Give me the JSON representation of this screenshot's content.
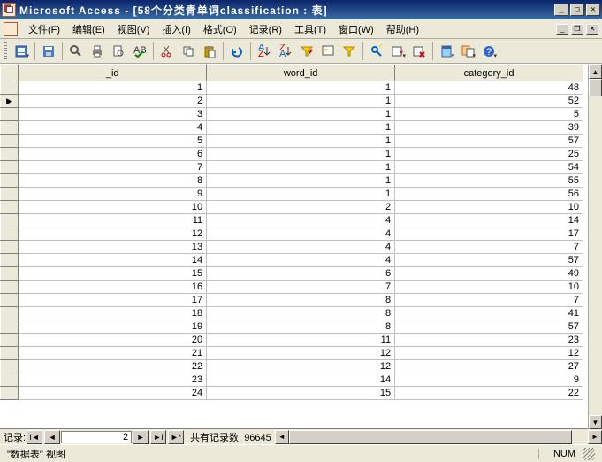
{
  "title": "Microsoft Access - [58个分类青单词classification : 表]",
  "menu": {
    "file": "文件(F)",
    "edit": "编辑(E)",
    "view": "视图(V)",
    "insert": "插入(I)",
    "format": "格式(O)",
    "records": "记录(R)",
    "tools": "工具(T)",
    "window": "窗口(W)",
    "help": "帮助(H)"
  },
  "columns": [
    "_id",
    "word_id",
    "category_id"
  ],
  "rows": [
    {
      "_id": 1,
      "word_id": 1,
      "category_id": 48
    },
    {
      "_id": 2,
      "word_id": 1,
      "category_id": 52
    },
    {
      "_id": 3,
      "word_id": 1,
      "category_id": 5
    },
    {
      "_id": 4,
      "word_id": 1,
      "category_id": 39
    },
    {
      "_id": 5,
      "word_id": 1,
      "category_id": 57
    },
    {
      "_id": 6,
      "word_id": 1,
      "category_id": 25
    },
    {
      "_id": 7,
      "word_id": 1,
      "category_id": 54
    },
    {
      "_id": 8,
      "word_id": 1,
      "category_id": 55
    },
    {
      "_id": 9,
      "word_id": 1,
      "category_id": 56
    },
    {
      "_id": 10,
      "word_id": 2,
      "category_id": 10
    },
    {
      "_id": 11,
      "word_id": 4,
      "category_id": 14
    },
    {
      "_id": 12,
      "word_id": 4,
      "category_id": 17
    },
    {
      "_id": 13,
      "word_id": 4,
      "category_id": 7
    },
    {
      "_id": 14,
      "word_id": 4,
      "category_id": 57
    },
    {
      "_id": 15,
      "word_id": 6,
      "category_id": 49
    },
    {
      "_id": 16,
      "word_id": 7,
      "category_id": 10
    },
    {
      "_id": 17,
      "word_id": 8,
      "category_id": 7
    },
    {
      "_id": 18,
      "word_id": 8,
      "category_id": 41
    },
    {
      "_id": 19,
      "word_id": 8,
      "category_id": 57
    },
    {
      "_id": 20,
      "word_id": 11,
      "category_id": 23
    },
    {
      "_id": 21,
      "word_id": 12,
      "category_id": 12
    },
    {
      "_id": 22,
      "word_id": 12,
      "category_id": 27
    },
    {
      "_id": 23,
      "word_id": 14,
      "category_id": 9
    },
    {
      "_id": 24,
      "word_id": 15,
      "category_id": 22
    }
  ],
  "selected_row": 1,
  "nav": {
    "label": "记录:",
    "current": "2",
    "total_label": "共有记录数:",
    "total": "96645"
  },
  "status": {
    "view": "\"数据表\" 视图",
    "num": "NUM"
  }
}
